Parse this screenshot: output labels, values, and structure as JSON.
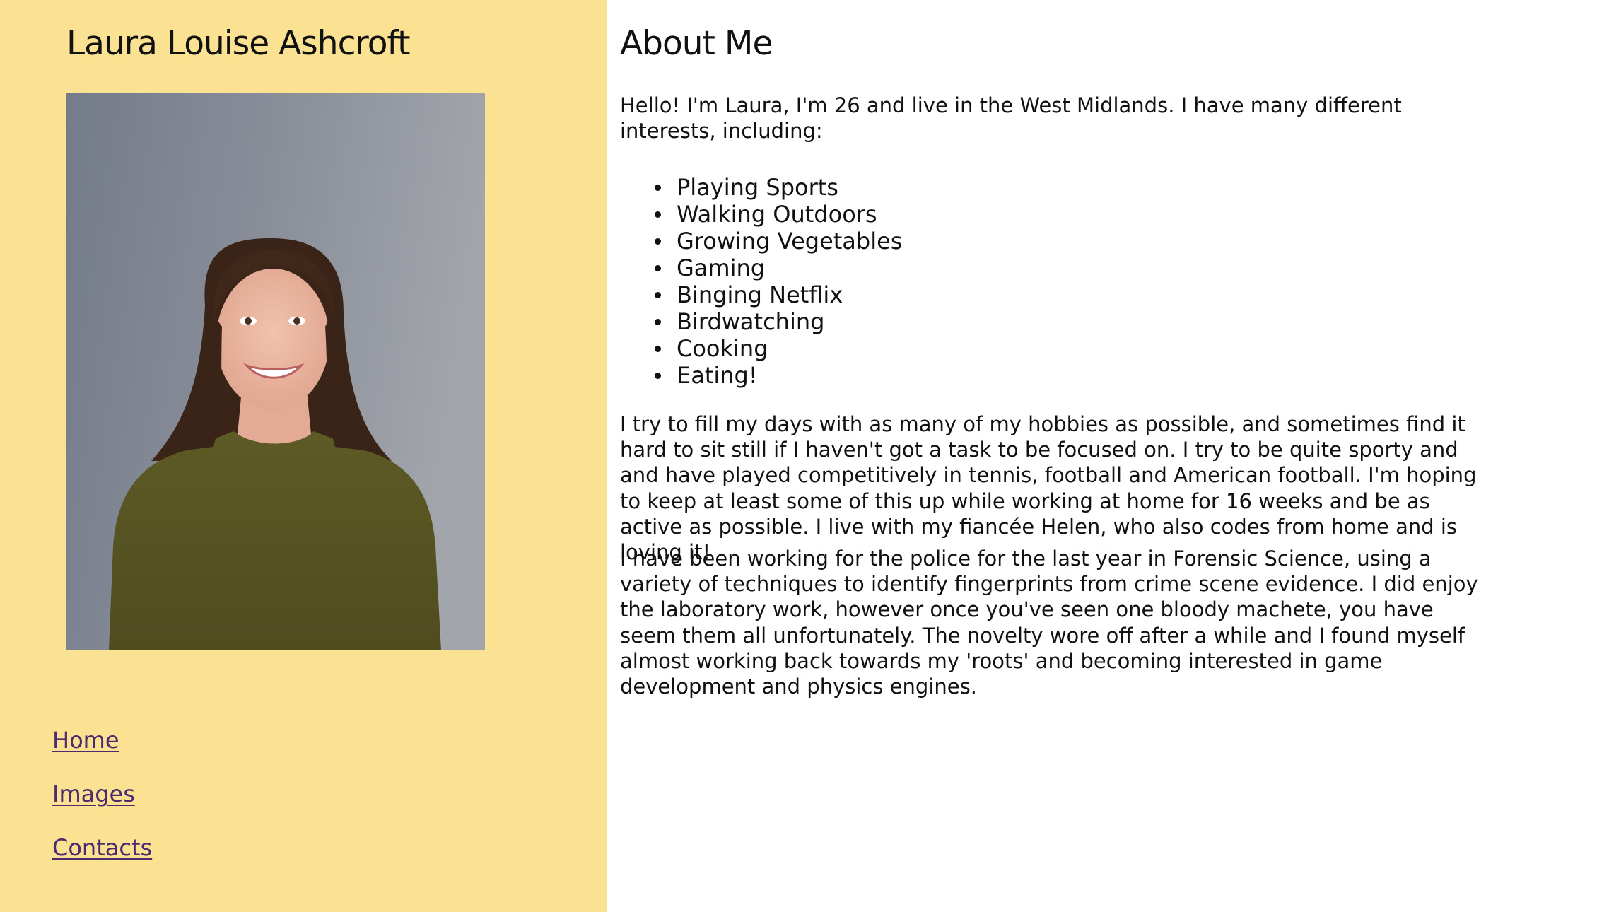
{
  "sidebar": {
    "name": "Laura Louise Ashcroft",
    "photo_alt": "Photo of Laura",
    "nav": [
      {
        "label": "Home"
      },
      {
        "label": "Images"
      },
      {
        "label": "Contacts"
      }
    ],
    "background_color": "#fae292",
    "link_color": "#4b2b6e"
  },
  "main": {
    "heading": "About Me",
    "intro": "Hello! I'm Laura, I'm 26 and live in the West Midlands. I have many different interests, including:",
    "hobbies": [
      "Playing Sports",
      "Walking Outdoors",
      "Growing Vegetables",
      "Gaming",
      "Binging Netflix",
      "Birdwatching",
      "Cooking",
      "Eating!"
    ],
    "paragraph_1": "I try to fill my days with as many of my hobbies as possible, and sometimes find it hard to sit still if I haven't got a task to be focused on. I try to be quite sporty and and have played competitively in tennis, football and American football. I'm hoping to keep at least some of this up while working at home for 16 weeks and be as active as possible. I live with my fiancée Helen, who also codes from home and is loving it!",
    "paragraph_2": "I have been working for the police for the last year in Forensic Science, using a variety of techniques to identify fingerprints from crime scene evidence. I did enjoy the laboratory work, however once you've seen one bloody machete, you have seem them all unfortunately. The novelty wore off after a while and I found myself almost working back towards my 'roots' and becoming interested in game development and physics engines."
  }
}
